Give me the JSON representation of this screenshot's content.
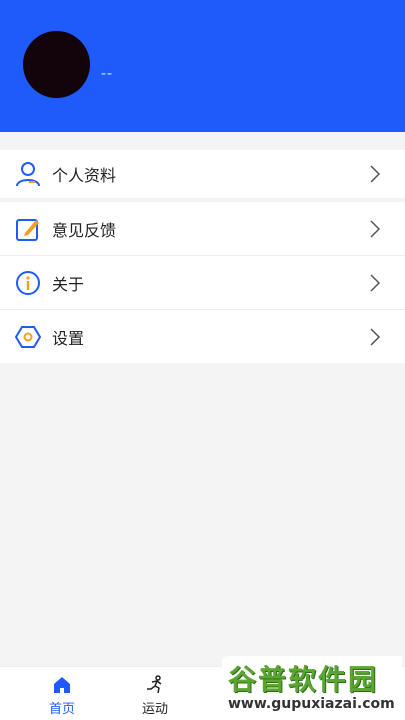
{
  "profile": {
    "username": "--",
    "avatar_color": "#12040a"
  },
  "theme": {
    "primary": "#1e5bfa",
    "accent_orange": "#f0a020"
  },
  "menu": {
    "items": [
      {
        "label": "个人资料",
        "icon": "user-icon"
      },
      {
        "label": "意见反馈",
        "icon": "edit-icon"
      },
      {
        "label": "关于",
        "icon": "info-icon"
      },
      {
        "label": "设置",
        "icon": "settings-hexagon-icon"
      }
    ]
  },
  "tabbar": {
    "tabs": [
      {
        "label": "首页",
        "icon": "home-icon",
        "active": true
      },
      {
        "label": "运动",
        "icon": "running-icon",
        "active": false
      }
    ]
  },
  "watermark": {
    "title": "谷普软件园",
    "url": "www.gupuxiazai.com"
  }
}
